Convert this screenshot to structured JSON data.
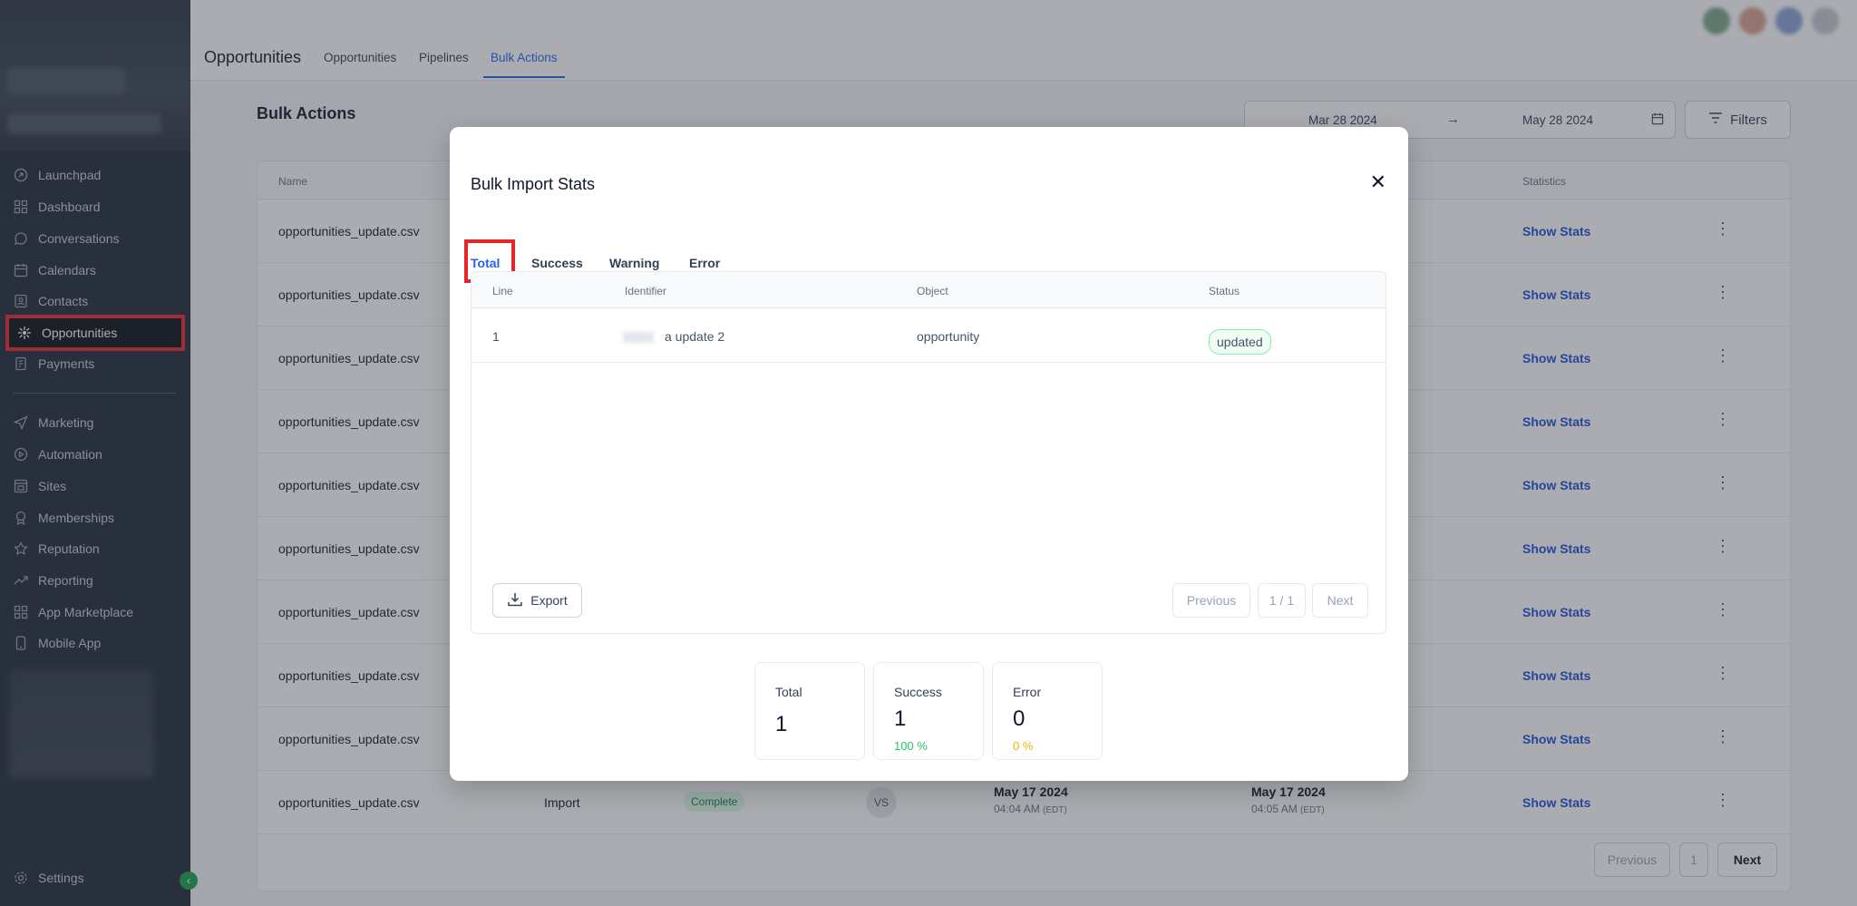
{
  "sidebar": {
    "items": [
      {
        "label": "Launchpad",
        "icon": "launchpad-icon"
      },
      {
        "label": "Dashboard",
        "icon": "dashboard-icon"
      },
      {
        "label": "Conversations",
        "icon": "chat-icon"
      },
      {
        "label": "Calendars",
        "icon": "calendar-icon"
      },
      {
        "label": "Contacts",
        "icon": "contacts-icon"
      },
      {
        "label": "Opportunities",
        "icon": "opportunities-icon"
      },
      {
        "label": "Payments",
        "icon": "payments-icon"
      },
      {
        "label": "Marketing",
        "icon": "send-icon"
      },
      {
        "label": "Automation",
        "icon": "automation-icon"
      },
      {
        "label": "Sites",
        "icon": "sites-icon"
      },
      {
        "label": "Memberships",
        "icon": "award-icon"
      },
      {
        "label": "Reputation",
        "icon": "star-icon"
      },
      {
        "label": "Reporting",
        "icon": "trend-icon"
      },
      {
        "label": "App Marketplace",
        "icon": "grid-icon"
      },
      {
        "label": "Mobile App",
        "icon": "mobile-icon"
      }
    ],
    "settings_label": "Settings"
  },
  "header": {
    "title": "Opportunities",
    "tabs": [
      "Opportunities",
      "Pipelines",
      "Bulk Actions"
    ],
    "active_tab": "Bulk Actions"
  },
  "page": {
    "title": "Bulk Actions",
    "date_from": "Mar 28 2024",
    "date_to": "May 28 2024",
    "filters_label": "Filters"
  },
  "table": {
    "headers": {
      "name": "Name",
      "statistics": "Statistics"
    },
    "rows": [
      {
        "name": "opportunities_update.csv",
        "stats": "Show Stats"
      },
      {
        "name": "opportunities_update.csv",
        "stats": "Show Stats"
      },
      {
        "name": "opportunities_update.csv",
        "stats": "Show Stats"
      },
      {
        "name": "opportunities_update.csv",
        "stats": "Show Stats"
      },
      {
        "name": "opportunities_update.csv",
        "stats": "Show Stats"
      },
      {
        "name": "opportunities_update.csv",
        "stats": "Show Stats"
      },
      {
        "name": "opportunities_update.csv",
        "stats": "Show Stats"
      },
      {
        "name": "opportunities_update.csv",
        "stats": "Show Stats"
      },
      {
        "name": "opportunities_update.csv",
        "stats": "Show Stats"
      },
      {
        "name": "opportunities_update.csv",
        "stats": "Show Stats",
        "type": "Import",
        "status": "Complete",
        "user": "VS",
        "date1": "May 17 2024",
        "time1": "04:04 AM",
        "tz1": "(EDT)",
        "date2": "May 17 2024",
        "time2": "04:05 AM",
        "tz2": "(EDT)"
      }
    ],
    "pager": {
      "previous": "Previous",
      "page": "1",
      "next": "Next"
    }
  },
  "modal": {
    "title": "Bulk Import Stats",
    "tabs": [
      "Total",
      "Success",
      "Warning",
      "Error"
    ],
    "active_tab": "Total",
    "columns": [
      "Line",
      "Identifier",
      "Object",
      "Status"
    ],
    "rows": [
      {
        "line": "1",
        "identifier": "a update 2",
        "object": "opportunity",
        "status": "updated"
      }
    ],
    "export_label": "Export",
    "pager": {
      "previous": "Previous",
      "page": "1 / 1",
      "next": "Next"
    },
    "stats": {
      "total": {
        "label": "Total",
        "value": "1"
      },
      "success": {
        "label": "Success",
        "value": "1",
        "pct": "100 %"
      },
      "error": {
        "label": "Error",
        "value": "0",
        "pct": "0 %"
      }
    }
  },
  "colors": {
    "accent": "#2563eb",
    "highlight": "#e5262b",
    "success": "#16a34a",
    "warning": "#eab308"
  }
}
